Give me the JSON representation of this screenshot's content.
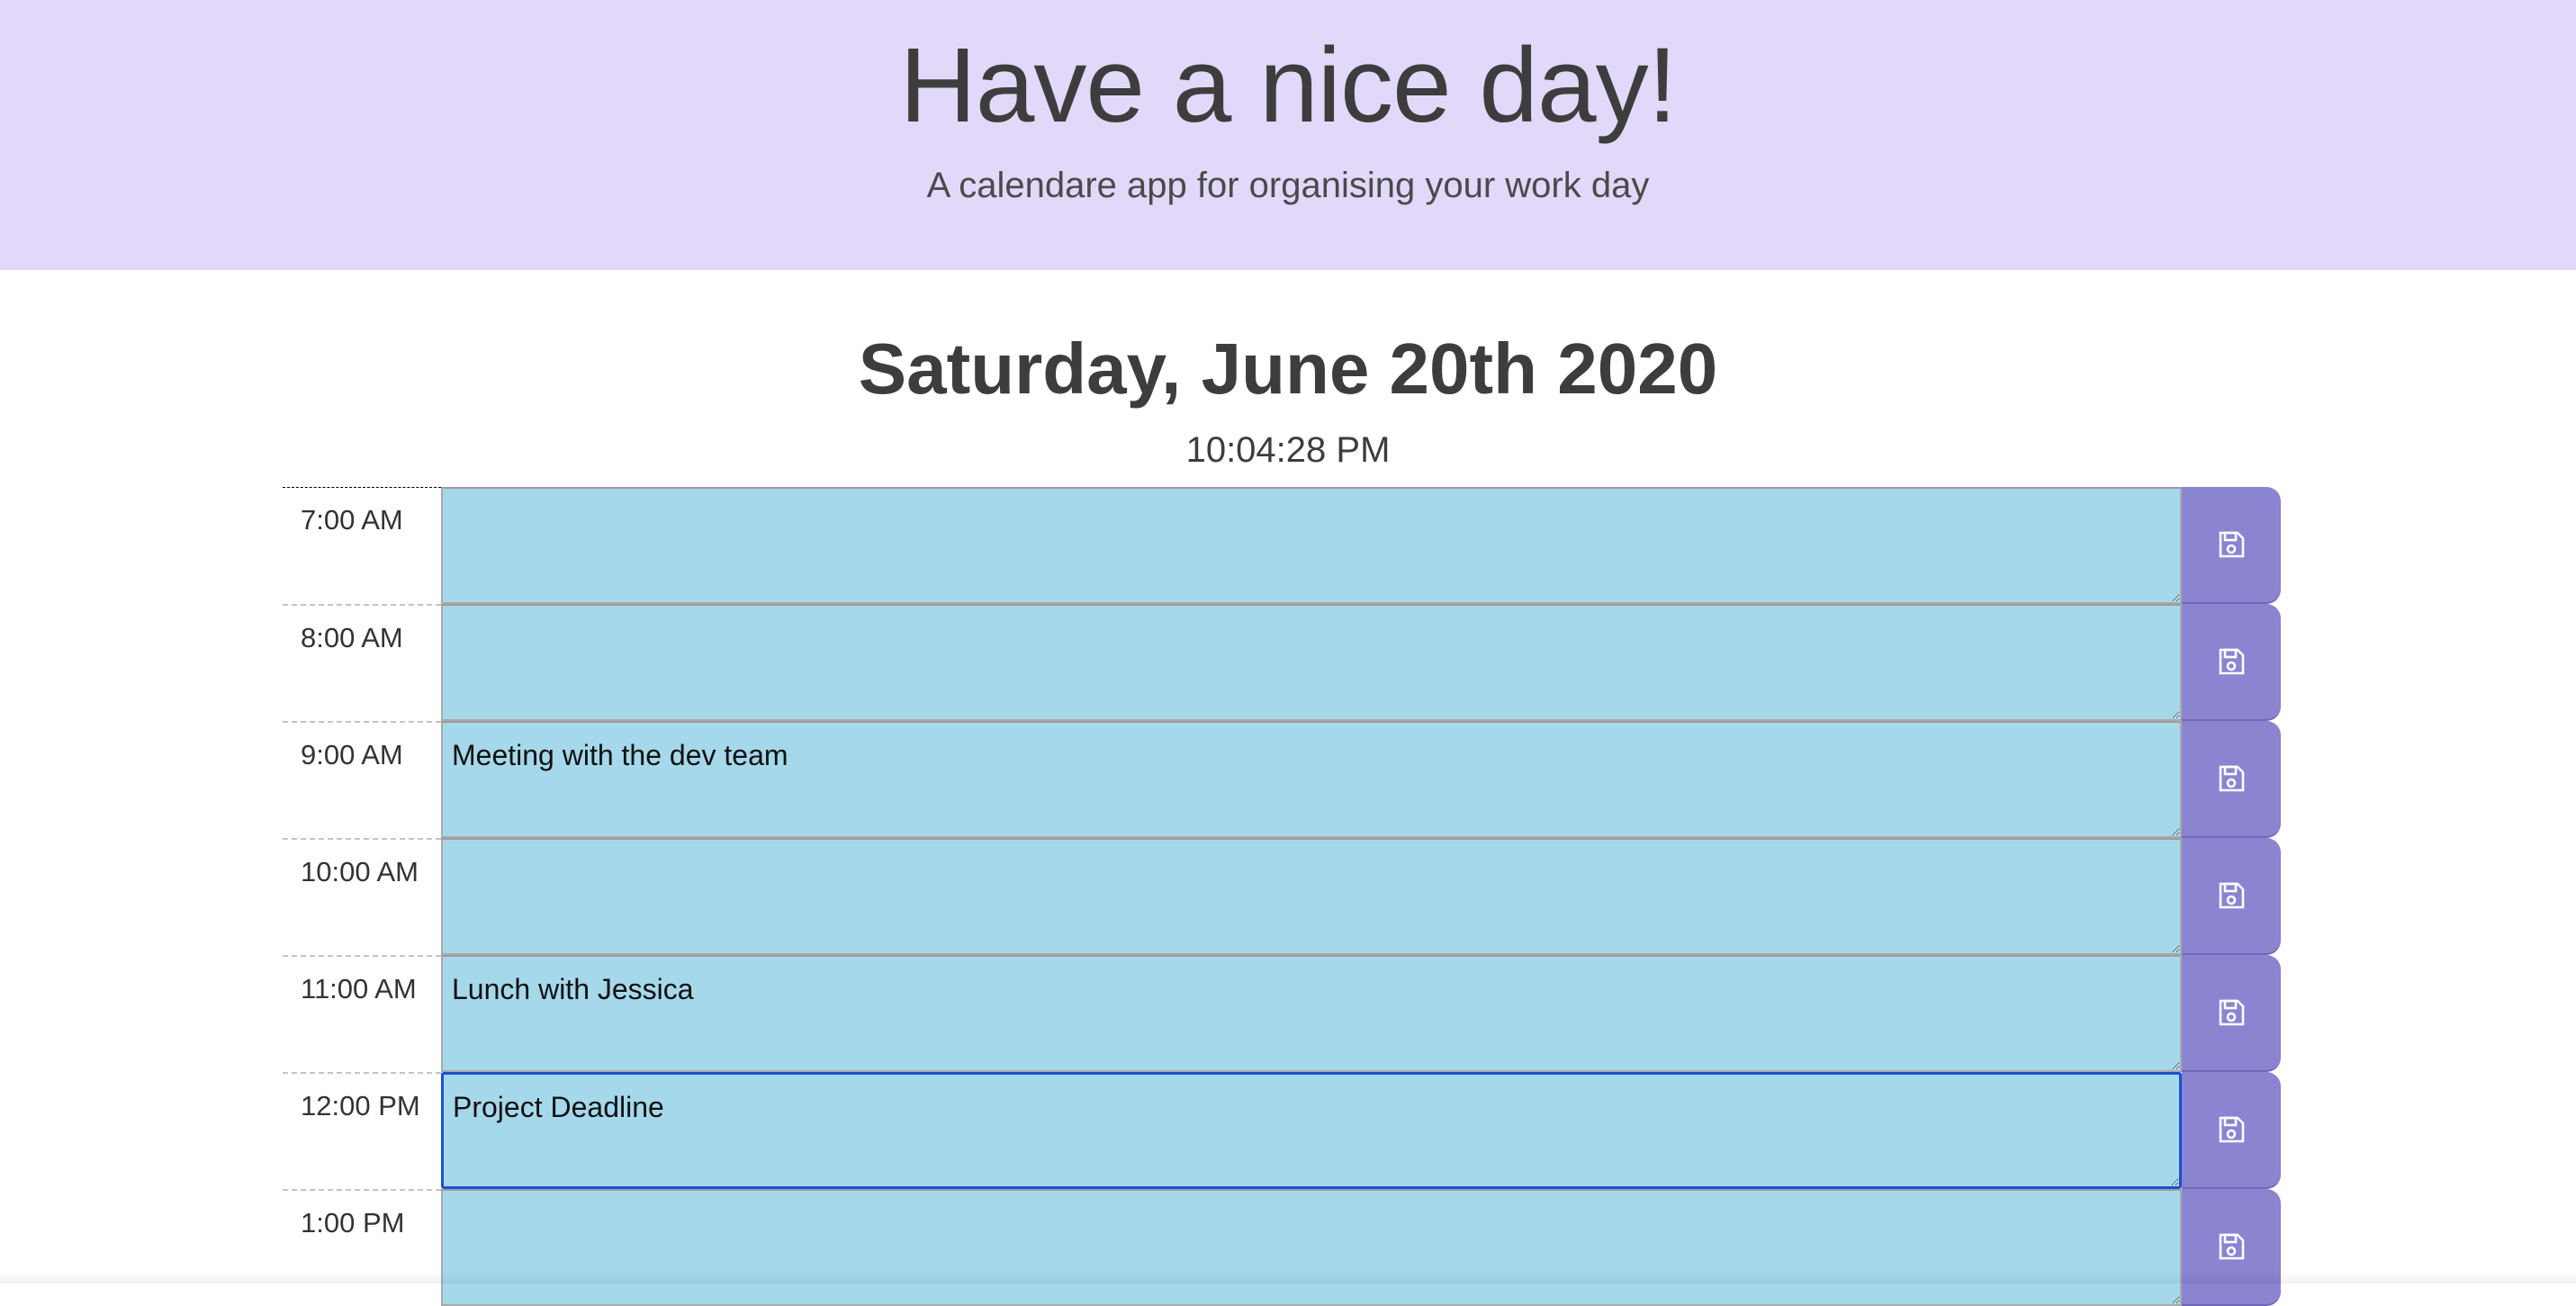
{
  "header": {
    "title": "Have a nice day!",
    "subtitle": "A calendare app for organising your work day"
  },
  "date": {
    "current_date": "Saturday, June 20th 2020",
    "current_time": "10:04:28 PM"
  },
  "rows": [
    {
      "hour": "7:00 AM",
      "text": ""
    },
    {
      "hour": "8:00 AM",
      "text": ""
    },
    {
      "hour": "9:00 AM",
      "text": "Meeting with the dev team"
    },
    {
      "hour": "10:00 AM",
      "text": ""
    },
    {
      "hour": "11:00 AM",
      "text": "Lunch with Jessica"
    },
    {
      "hour": "12:00 PM",
      "text": "Project Deadline"
    },
    {
      "hour": "1:00 PM",
      "text": ""
    }
  ],
  "colors": {
    "header_bg": "#e2d8fa",
    "row_bg": "#a6d8eb",
    "save_button": "#8a84d1",
    "focus_border": "#1e4fd0"
  },
  "icons": {
    "save": "floppy-disk-icon"
  }
}
